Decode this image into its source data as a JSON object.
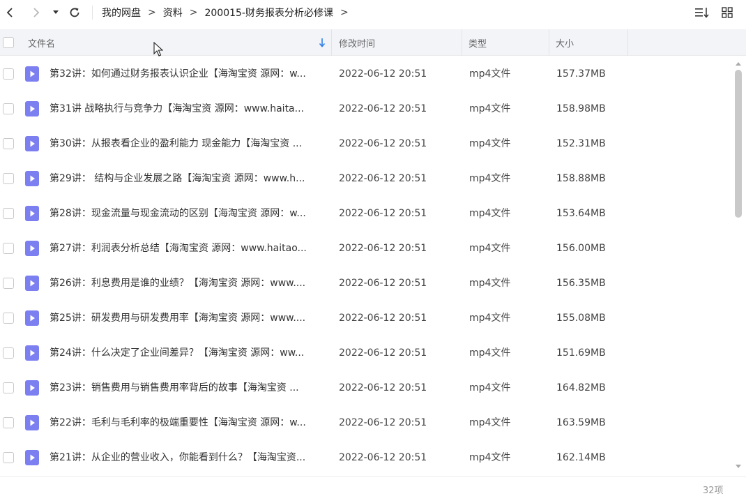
{
  "breadcrumb": [
    "我的网盘",
    "资料",
    "200015-财务报表分析必修课"
  ],
  "breadcrumb_separator": ">",
  "columns": {
    "name": "文件名",
    "modified": "修改时间",
    "type": "类型",
    "size": "大小"
  },
  "files": [
    {
      "name": "第32讲：如何通过财务报表认识企业【海淘宝资 源网：w...",
      "modified": "2022-06-12 20:51",
      "type": "mp4文件",
      "size": "157.37MB"
    },
    {
      "name": "第31讲 战略执行与竞争力【海淘宝资 源网：www.haita...",
      "modified": "2022-06-12 20:51",
      "type": "mp4文件",
      "size": "158.98MB"
    },
    {
      "name": "第30讲：从报表看企业的盈利能力 现金能力【海淘宝资 ...",
      "modified": "2022-06-12 20:51",
      "type": "mp4文件",
      "size": "152.31MB"
    },
    {
      "name": "第29讲： 结构与企业发展之路【海淘宝资 源网：www.h...",
      "modified": "2022-06-12 20:51",
      "type": "mp4文件",
      "size": "158.88MB"
    },
    {
      "name": "第28讲：现金流量与现金流动的区别【海淘宝资 源网：w...",
      "modified": "2022-06-12 20:51",
      "type": "mp4文件",
      "size": "153.64MB"
    },
    {
      "name": "第27讲：利润表分析总结【海淘宝资 源网：www.haitao...",
      "modified": "2022-06-12 20:51",
      "type": "mp4文件",
      "size": "156.00MB"
    },
    {
      "name": "第26讲：利息费用是谁的业绩？【海淘宝资 源网：www....",
      "modified": "2022-06-12 20:51",
      "type": "mp4文件",
      "size": "156.35MB"
    },
    {
      "name": "第25讲：研发费用与研发费用率【海淘宝资 源网：www....",
      "modified": "2022-06-12 20:51",
      "type": "mp4文件",
      "size": "155.08MB"
    },
    {
      "name": "第24讲：什么决定了企业间差异？【海淘宝资 源网：ww...",
      "modified": "2022-06-12 20:51",
      "type": "mp4文件",
      "size": "151.69MB"
    },
    {
      "name": "第23讲：销售费用与销售费用率背后的故事【海淘宝资 ...",
      "modified": "2022-06-12 20:51",
      "type": "mp4文件",
      "size": "164.82MB"
    },
    {
      "name": "第22讲：毛利与毛利率的极端重要性【海淘宝资 源网：w...",
      "modified": "2022-06-12 20:51",
      "type": "mp4文件",
      "size": "163.59MB"
    },
    {
      "name": "第21讲：从企业的营业收入，你能看到什么？【海淘宝资...",
      "modified": "2022-06-12 20:51",
      "type": "mp4文件",
      "size": "162.14MB"
    }
  ],
  "footer": {
    "count": "32项"
  },
  "icons": {
    "back": "chevron-left-icon",
    "forward": "chevron-right-icon",
    "history": "caret-down-icon",
    "refresh": "refresh-icon",
    "sort": "sort-list-icon",
    "grid": "grid-view-icon",
    "file": "video-file-icon"
  },
  "colors": {
    "file_icon": "#7b7ff0",
    "header_bg": "#f3f4f8",
    "sort_arrow": "#2b7de9"
  }
}
